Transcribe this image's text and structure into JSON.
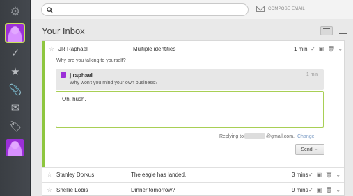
{
  "search": {
    "placeholder": ""
  },
  "compose": {
    "label": "COMPOSE EMAIL"
  },
  "inbox": {
    "title": "Your Inbox"
  },
  "open_message": {
    "from": "JR Raphael",
    "subject": "Multiple identities",
    "time": "1 min",
    "snippet": "Why are you talking to yourself?",
    "reply": {
      "name": "j raphael",
      "time": "1 min",
      "text": "Why won't you mind your own business?"
    },
    "draft": "Oh, hush.",
    "replying_to_prefix": "Replying to",
    "replying_to_domain": "@gmail.com.",
    "change_label": "Change",
    "send_label": "Send →"
  },
  "messages": [
    {
      "from": "Stanley Dorkus",
      "subject": "The eagle has landed.",
      "time": "3 mins"
    },
    {
      "from": "Shellie Lobis",
      "subject": "Dinner tomorrow?",
      "time": "9 mins"
    }
  ],
  "icons": {
    "rail": [
      "gear-icon",
      "avatar",
      "check-icon",
      "star-icon",
      "paperclip-icon",
      "envelope-icon",
      "tag-icon",
      "avatar"
    ],
    "row_actions": [
      "check-icon",
      "archive-icon",
      "trash-icon",
      "chevron-down-icon"
    ]
  },
  "colors": {
    "accent_green": "#8ec63f",
    "avatar_purple": "#9b2fd8",
    "rail_dark": "#3a3e43"
  }
}
